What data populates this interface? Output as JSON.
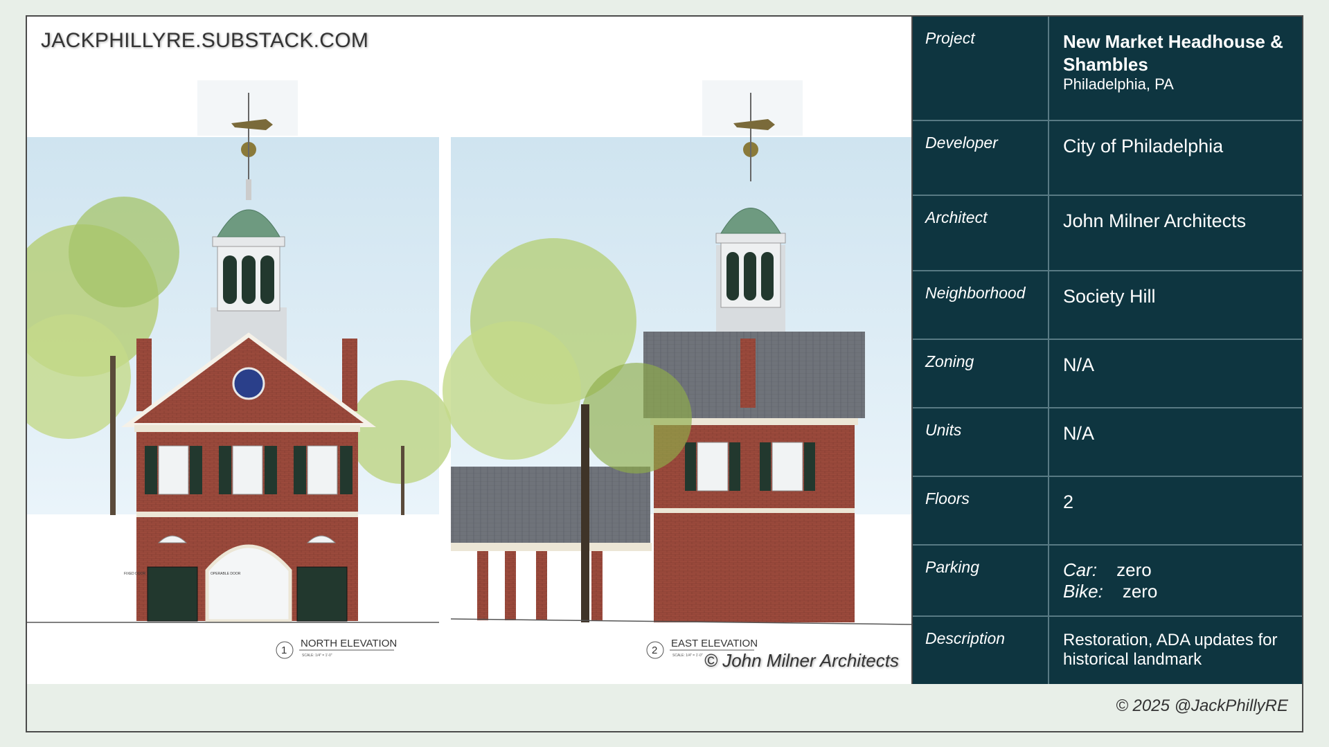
{
  "header": {
    "site_url": "JACKPHILLYRE.SUBSTACK.COM"
  },
  "image": {
    "credit": "© John Milner Architects",
    "elevations": [
      {
        "number": "1",
        "label": "NORTH ELEVATION",
        "scale": "SCALE: 1/4\" = 1'-0\""
      },
      {
        "number": "2",
        "label": "EAST ELEVATION",
        "scale": "SCALE: 1/4\" = 1'-0\""
      }
    ],
    "door_notes": {
      "left": "FIXED DOOR",
      "right": "OPERABLE DOOR"
    }
  },
  "info": {
    "project": {
      "label": "Project",
      "name": "New Market Headhouse & Shambles",
      "location": "Philadelphia, PA"
    },
    "developer": {
      "label": "Developer",
      "value": "City of Philadelphia"
    },
    "architect": {
      "label": "Architect",
      "value": "John Milner Architects"
    },
    "neighborhood": {
      "label": "Neighborhood",
      "value": "Society Hill"
    },
    "zoning": {
      "label": "Zoning",
      "value": "N/A"
    },
    "units": {
      "label": "Units",
      "value": "N/A"
    },
    "floors": {
      "label": "Floors",
      "value": "2"
    },
    "parking": {
      "label": "Parking",
      "car_label": "Car:",
      "car_value": "zero",
      "bike_label": "Bike:",
      "bike_value": "zero"
    },
    "description": {
      "label": "Description",
      "value": "Restoration, ADA updates for historical landmark"
    }
  },
  "footer": {
    "copyright": "© 2025 @JackPhillyRE"
  },
  "colors": {
    "table_bg": "#0e3540",
    "page_bg": "#e8efe8",
    "brick": "#9b4a3c",
    "shutter": "#22382e",
    "cupola": "#6e9a80"
  }
}
